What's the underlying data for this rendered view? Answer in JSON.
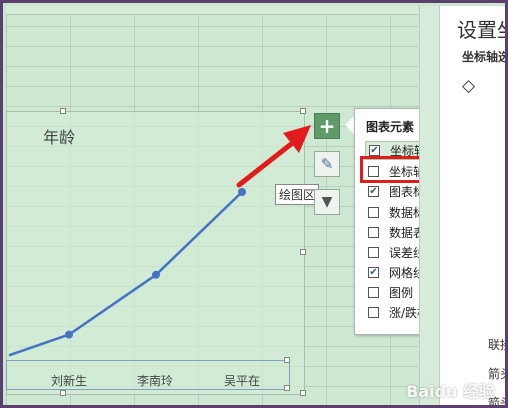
{
  "chart": {
    "title": "年龄",
    "categories": [
      "刘新生",
      "李南玲",
      "吴平在"
    ]
  },
  "chart_data": {
    "type": "line",
    "title": "年龄",
    "categories": [
      "",
      "刘新生",
      "李南玲",
      "吴平在"
    ],
    "values": [
      null,
      9,
      22,
      40
    ]
  },
  "tooltip": "绘图区",
  "side_buttons": {
    "plus": "+",
    "brush": "✎",
    "filter": "▼"
  },
  "chart_elements_panel": {
    "title": "图表元素",
    "options": [
      {
        "label": "坐标轴",
        "checked": true
      },
      {
        "label": "坐标轴标题",
        "checked": false
      },
      {
        "label": "图表标题",
        "checked": true
      },
      {
        "label": "数据标签",
        "checked": false
      },
      {
        "label": "数据表",
        "checked": false
      },
      {
        "label": "误差线",
        "checked": false
      },
      {
        "label": "网格线",
        "checked": true
      },
      {
        "label": "图例",
        "checked": false
      },
      {
        "label": "涨/跌柱线",
        "checked": false
      }
    ]
  },
  "format_pane": {
    "title": "设置坐",
    "subtitle": "坐标轴选",
    "items": [
      "联接",
      "箭头",
      "箭头"
    ]
  },
  "watermark": "Baidu 经验",
  "colors": {
    "accent": "#4472c4",
    "highlight": "#e21c1c",
    "plus_button": "#5f9b69"
  }
}
